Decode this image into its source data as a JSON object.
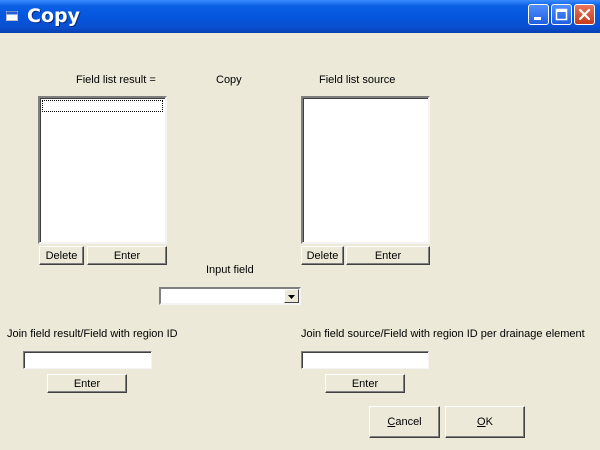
{
  "window": {
    "title": "Copy"
  },
  "labels": {
    "field_list_result": "Field list result =",
    "copy": "Copy",
    "field_list_source": "Field list source",
    "input_field": "Input field",
    "join_result": "Join field result/Field with region ID",
    "join_source": "Join field source/Field with region ID per drainage element"
  },
  "buttons": {
    "delete_left": "Delete",
    "enter_left": "Enter",
    "delete_right": "Delete",
    "enter_right": "Enter",
    "enter_join_result": "Enter",
    "enter_join_source": "Enter",
    "cancel_rest": "ancel",
    "cancel_mnemonic": "C",
    "ok_rest": "K",
    "ok_mnemonic": "O"
  },
  "inputs": {
    "input_field_value": "",
    "join_result_value": "",
    "join_source_value": ""
  },
  "colors": {
    "titlebar": "#0556de",
    "face": "#ece9d8"
  }
}
